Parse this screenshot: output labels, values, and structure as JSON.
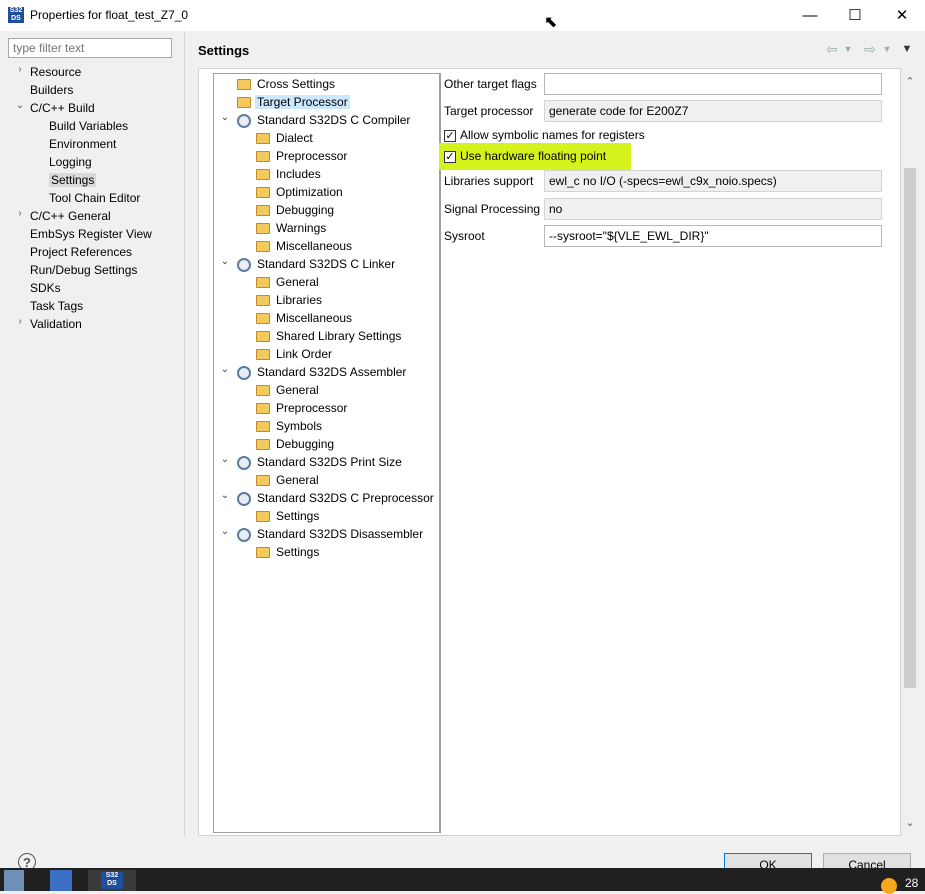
{
  "window": {
    "title": "Properties for float_test_Z7_0",
    "icon_text": "S32\nDS",
    "controls": {
      "minimize": "—",
      "maximize": "☐",
      "close": "✕"
    }
  },
  "sidebar": {
    "filter_placeholder": "type filter text",
    "items": [
      {
        "label": "Resource",
        "indent": 0,
        "chevron": "›"
      },
      {
        "label": "Builders",
        "indent": 0,
        "chevron": ""
      },
      {
        "label": "C/C++ Build",
        "indent": 0,
        "chevron": "⌄"
      },
      {
        "label": "Build Variables",
        "indent": 1,
        "chevron": ""
      },
      {
        "label": "Environment",
        "indent": 1,
        "chevron": ""
      },
      {
        "label": "Logging",
        "indent": 1,
        "chevron": ""
      },
      {
        "label": "Settings",
        "indent": 1,
        "chevron": "",
        "selected": true
      },
      {
        "label": "Tool Chain Editor",
        "indent": 1,
        "chevron": ""
      },
      {
        "label": "C/C++ General",
        "indent": 0,
        "chevron": "›"
      },
      {
        "label": "EmbSys Register View",
        "indent": 0,
        "chevron": ""
      },
      {
        "label": "Project References",
        "indent": 0,
        "chevron": ""
      },
      {
        "label": "Run/Debug Settings",
        "indent": 0,
        "chevron": ""
      },
      {
        "label": "SDKs",
        "indent": 0,
        "chevron": ""
      },
      {
        "label": "Task Tags",
        "indent": 0,
        "chevron": ""
      },
      {
        "label": "Validation",
        "indent": 0,
        "chevron": "›"
      }
    ]
  },
  "header": {
    "title": "Settings",
    "icons": [
      "back-arrow-icon",
      "forward-arrow-icon",
      "view-menu-icon"
    ]
  },
  "tool_tree": [
    {
      "label": "Cross Settings",
      "level": 0,
      "icon": "folder-icon",
      "chevron": ""
    },
    {
      "label": "Target Processor",
      "level": 0,
      "icon": "folder-icon",
      "chevron": "",
      "selected": true
    },
    {
      "label": "Standard S32DS C Compiler",
      "level": 0,
      "icon": "gear-icon",
      "chevron": "⌄"
    },
    {
      "label": "Dialect",
      "level": 1,
      "icon": "folder-icon",
      "chevron": ""
    },
    {
      "label": "Preprocessor",
      "level": 1,
      "icon": "folder-icon",
      "chevron": ""
    },
    {
      "label": "Includes",
      "level": 1,
      "icon": "folder-icon",
      "chevron": ""
    },
    {
      "label": "Optimization",
      "level": 1,
      "icon": "folder-icon",
      "chevron": ""
    },
    {
      "label": "Debugging",
      "level": 1,
      "icon": "folder-icon",
      "chevron": ""
    },
    {
      "label": "Warnings",
      "level": 1,
      "icon": "folder-icon",
      "chevron": ""
    },
    {
      "label": "Miscellaneous",
      "level": 1,
      "icon": "folder-icon",
      "chevron": ""
    },
    {
      "label": "Standard S32DS C Linker",
      "level": 0,
      "icon": "gear-icon",
      "chevron": "⌄"
    },
    {
      "label": "General",
      "level": 1,
      "icon": "folder-icon",
      "chevron": ""
    },
    {
      "label": "Libraries",
      "level": 1,
      "icon": "folder-icon",
      "chevron": ""
    },
    {
      "label": "Miscellaneous",
      "level": 1,
      "icon": "folder-icon",
      "chevron": ""
    },
    {
      "label": "Shared Library Settings",
      "level": 1,
      "icon": "folder-icon",
      "chevron": ""
    },
    {
      "label": "Link Order",
      "level": 1,
      "icon": "folder-icon",
      "chevron": ""
    },
    {
      "label": "Standard S32DS Assembler",
      "level": 0,
      "icon": "gear-icon",
      "chevron": "⌄"
    },
    {
      "label": "General",
      "level": 1,
      "icon": "folder-icon",
      "chevron": ""
    },
    {
      "label": "Preprocessor",
      "level": 1,
      "icon": "folder-icon",
      "chevron": ""
    },
    {
      "label": "Symbols",
      "level": 1,
      "icon": "folder-icon",
      "chevron": ""
    },
    {
      "label": "Debugging",
      "level": 1,
      "icon": "folder-icon",
      "chevron": ""
    },
    {
      "label": "Standard S32DS Print Size",
      "level": 0,
      "icon": "gear-icon",
      "chevron": "⌄"
    },
    {
      "label": "General",
      "level": 1,
      "icon": "folder-icon",
      "chevron": ""
    },
    {
      "label": "Standard S32DS C Preprocessor",
      "level": 0,
      "icon": "gear-icon",
      "chevron": "⌄"
    },
    {
      "label": "Settings",
      "level": 1,
      "icon": "folder-icon",
      "chevron": ""
    },
    {
      "label": "Standard S32DS Disassembler",
      "level": 0,
      "icon": "gear-icon",
      "chevron": "⌄"
    },
    {
      "label": "Settings",
      "level": 1,
      "icon": "folder-icon",
      "chevron": ""
    }
  ],
  "form": {
    "other_target_flags": {
      "label": "Other target flags",
      "value": ""
    },
    "target_processor": {
      "label": "Target processor",
      "value": "generate code for E200Z7"
    },
    "allow_symbolic": {
      "label": "Allow symbolic names for registers",
      "checked": true,
      "check_glyph": "✓"
    },
    "use_hw_float": {
      "label": "Use hardware floating point",
      "checked": true,
      "check_glyph": "✓",
      "highlight_color": "#d6f21c"
    },
    "libraries_support": {
      "label": "Libraries support",
      "value": "ewl_c no I/O (-specs=ewl_c9x_noio.specs)"
    },
    "signal_processing": {
      "label": "Signal Processing",
      "value": "no"
    },
    "sysroot": {
      "label": "Sysroot",
      "value": "--sysroot=\"${VLE_EWL_DIR}\""
    }
  },
  "scrollbar": {
    "up": "⌃",
    "down": "⌄"
  },
  "footer": {
    "help": "?",
    "ok_label": "OK",
    "cancel_label": "Cancel"
  },
  "taskbar": {
    "app_label": "S32\nDS",
    "clock": "28"
  },
  "colors": {
    "selection": "#cce8ff",
    "highlight": "#d6f21c",
    "accent": "#0078d7"
  }
}
